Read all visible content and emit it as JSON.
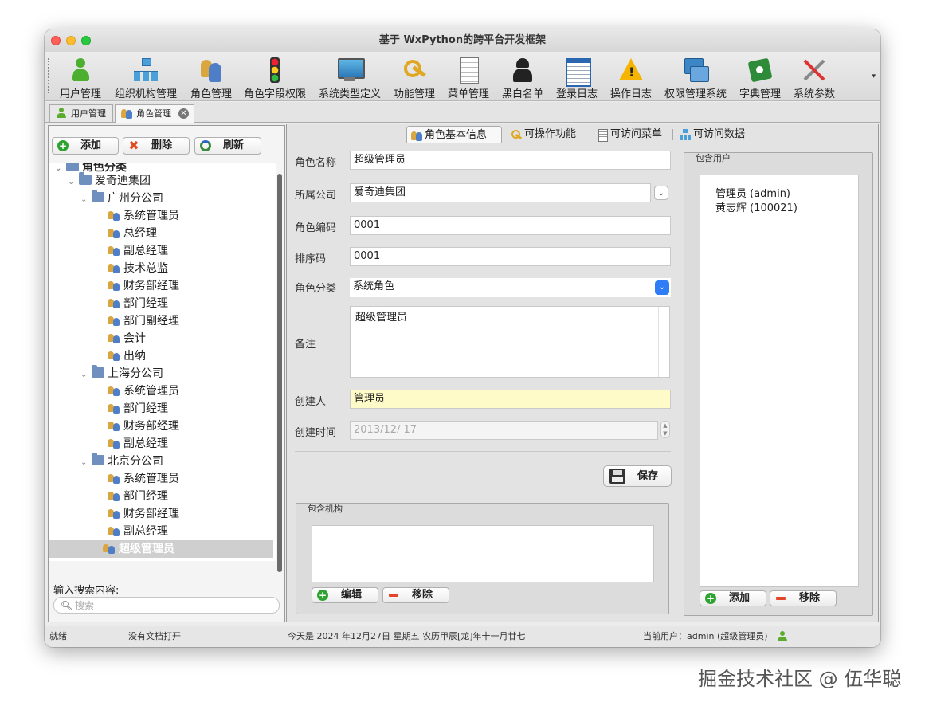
{
  "window": {
    "title": "基于 WxPython的跨平台开发框架"
  },
  "toolbar": {
    "items": [
      {
        "label": "用户管理",
        "icon": "user-icon"
      },
      {
        "label": "组织机构管理",
        "icon": "org-chart-icon"
      },
      {
        "label": "角色管理",
        "icon": "roles-icon"
      },
      {
        "label": "角色字段权限",
        "icon": "traffic-light-icon"
      },
      {
        "label": "系统类型定义",
        "icon": "monitor-icon"
      },
      {
        "label": "功能管理",
        "icon": "keys-icon"
      },
      {
        "label": "菜单管理",
        "icon": "menu-doc-icon"
      },
      {
        "label": "黑白名单",
        "icon": "spy-icon"
      },
      {
        "label": "登录日志",
        "icon": "log-window-icon"
      },
      {
        "label": "操作日志",
        "icon": "warning-icon"
      },
      {
        "label": "权限管理系统",
        "icon": "permission-icon"
      },
      {
        "label": "字典管理",
        "icon": "book-icon"
      },
      {
        "label": "系统参数",
        "icon": "tools-icon"
      }
    ],
    "more_glyph": "▾"
  },
  "doc_tabs": [
    {
      "label": "用户管理",
      "active": false
    },
    {
      "label": "角色管理",
      "active": true,
      "close_glyph": "✕"
    }
  ],
  "left_panel": {
    "add_label": "添加",
    "delete_label": "删除",
    "refresh_label": "刷新",
    "tree_root": "角色分类",
    "tree": [
      {
        "level": 1,
        "type": "folder",
        "label": "爱奇迪集团",
        "expanded": true
      },
      {
        "level": 2,
        "type": "folder",
        "label": "广州分公司",
        "expanded": true
      },
      {
        "level": 3,
        "type": "role",
        "label": "系统管理员"
      },
      {
        "level": 3,
        "type": "role",
        "label": "总经理"
      },
      {
        "level": 3,
        "type": "role",
        "label": "副总经理"
      },
      {
        "level": 3,
        "type": "role",
        "label": "技术总监"
      },
      {
        "level": 3,
        "type": "role",
        "label": "财务部经理"
      },
      {
        "level": 3,
        "type": "role",
        "label": "部门经理"
      },
      {
        "level": 3,
        "type": "role",
        "label": "部门副经理"
      },
      {
        "level": 3,
        "type": "role",
        "label": "会计"
      },
      {
        "level": 3,
        "type": "role",
        "label": "出纳"
      },
      {
        "level": 2,
        "type": "folder",
        "label": "上海分公司",
        "expanded": true
      },
      {
        "level": 3,
        "type": "role",
        "label": "系统管理员"
      },
      {
        "level": 3,
        "type": "role",
        "label": "部门经理"
      },
      {
        "level": 3,
        "type": "role",
        "label": "财务部经理"
      },
      {
        "level": 3,
        "type": "role",
        "label": "副总经理"
      },
      {
        "level": 2,
        "type": "folder",
        "label": "北京分公司",
        "expanded": true
      },
      {
        "level": 3,
        "type": "role",
        "label": "系统管理员"
      },
      {
        "level": 3,
        "type": "role",
        "label": "部门经理"
      },
      {
        "level": 3,
        "type": "role",
        "label": "财务部经理"
      },
      {
        "level": 3,
        "type": "role",
        "label": "副总经理"
      },
      {
        "level": 2,
        "type": "role",
        "label": "超级管理员",
        "selected": true
      }
    ],
    "search_label": "输入搜索内容:",
    "search_placeholder": "搜索"
  },
  "right_panel": {
    "tabs": [
      {
        "label": "角色基本信息",
        "active": true
      },
      {
        "label": "可操作功能",
        "active": false
      },
      {
        "label": "可访问菜单",
        "active": false
      },
      {
        "label": "可访问数据",
        "active": false
      }
    ],
    "form": {
      "role_name_label": "角色名称",
      "role_name_value": "超级管理员",
      "company_label": "所属公司",
      "company_value": "爱奇迪集团",
      "role_code_label": "角色编码",
      "role_code_value": "0001",
      "sort_label": "排序码",
      "sort_value": "0001",
      "category_label": "角色分类",
      "category_value": "系统角色",
      "remark_label": "备注",
      "remark_value": "超级管理员",
      "creator_label": "创建人",
      "creator_value": "管理员",
      "created_label": "创建时间",
      "created_value": "2013/12/ 17",
      "save_label": "保存"
    },
    "org_group": {
      "title": "包含机构",
      "edit_label": "编辑",
      "remove_label": "移除"
    },
    "user_group": {
      "title": "包含用户",
      "users": [
        "管理员 (admin)",
        "黄志辉 (100021)"
      ],
      "add_label": "添加",
      "remove_label": "移除"
    }
  },
  "statusbar": {
    "status": "就绪",
    "doc_status": "没有文档打开",
    "date_text": "今天是 2024 年12月27日 星期五 农历甲辰[龙]年十一月廿七",
    "user_text": "当前用户：admin (超级管理员)"
  },
  "watermark": "掘金技术社区 @ 伍华聪"
}
